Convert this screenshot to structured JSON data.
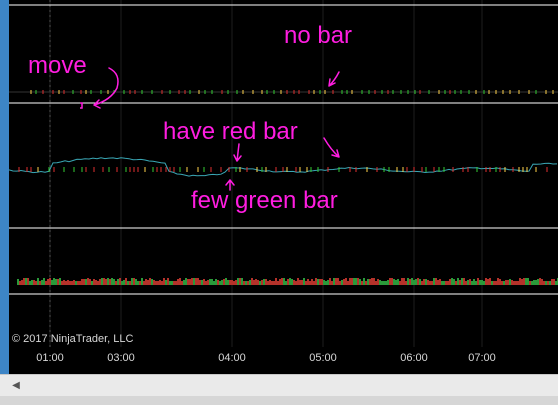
{
  "annotations": {
    "no_bar": "no bar",
    "move": "move",
    "have_red_bar": "have red bar",
    "few_green_bar": "few green bar"
  },
  "copyright": "© 2017 NinjaTrader, LLC",
  "time_axis": {
    "labels": [
      "01:00",
      "03:00",
      "04:00",
      "05:00",
      "06:00",
      "07:00"
    ]
  },
  "scrollbar": {
    "left_arrow_icon": "◀"
  },
  "colors": {
    "background": "#000000",
    "separator": "#ffffff",
    "annotation": "#ff1de0",
    "bar_red": "#e03030",
    "bar_green": "#33cc33",
    "line_teal": "#3aa7b5",
    "volume_red": "#b4322a",
    "volume_green": "#2a9a3a",
    "window_border": "#3d85c6"
  }
}
